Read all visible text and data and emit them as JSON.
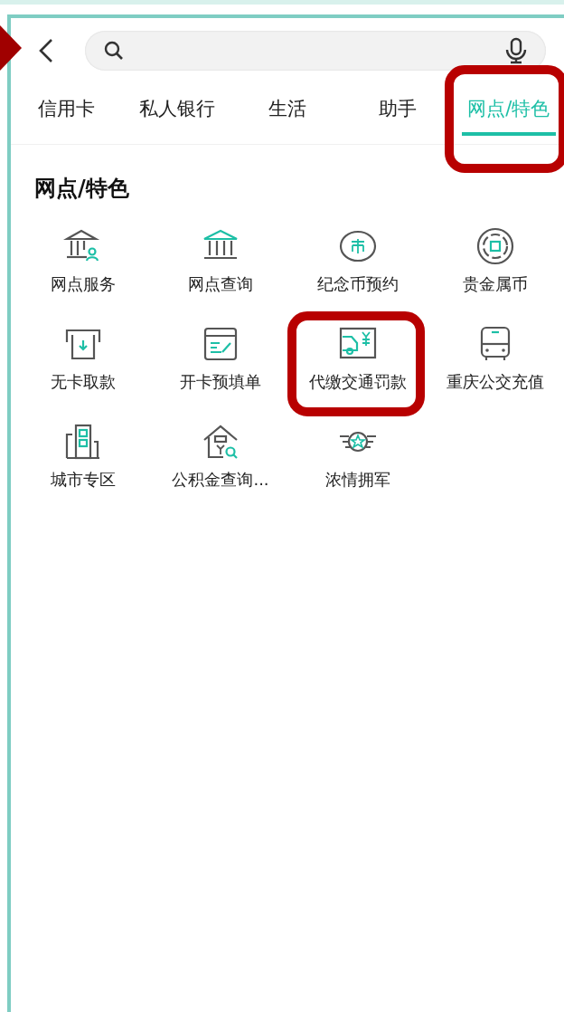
{
  "back_button": {
    "highlighted": true
  },
  "tabs": [
    {
      "label": "信用卡",
      "selected": false,
      "highlighted": false
    },
    {
      "label": "私人银行",
      "selected": false,
      "highlighted": false
    },
    {
      "label": "生活",
      "selected": false,
      "highlighted": false
    },
    {
      "label": "助手",
      "selected": false,
      "highlighted": false
    },
    {
      "label": "网点/特色",
      "selected": true,
      "highlighted": true
    }
  ],
  "section": {
    "title": "网点/特色",
    "items": [
      {
        "label": "网点服务",
        "kind": "branch-service",
        "highlighted": false
      },
      {
        "label": "网点查询",
        "kind": "branch-search",
        "highlighted": false
      },
      {
        "label": "纪念币预约",
        "kind": "coin",
        "highlighted": false
      },
      {
        "label": "贵金属币",
        "kind": "metal-coin",
        "highlighted": false
      },
      {
        "label": "无卡取款",
        "kind": "atm",
        "highlighted": false
      },
      {
        "label": "开卡预填单",
        "kind": "form",
        "highlighted": false
      },
      {
        "label": "代缴交通罚款",
        "kind": "traffic-fine",
        "highlighted": true
      },
      {
        "label": "重庆公交充值",
        "kind": "bus",
        "highlighted": false
      },
      {
        "label": "城市专区",
        "kind": "city",
        "highlighted": false
      },
      {
        "label": "公积金查询...",
        "kind": "fund",
        "highlighted": false
      },
      {
        "label": "浓情拥军",
        "kind": "army",
        "highlighted": false
      }
    ]
  }
}
